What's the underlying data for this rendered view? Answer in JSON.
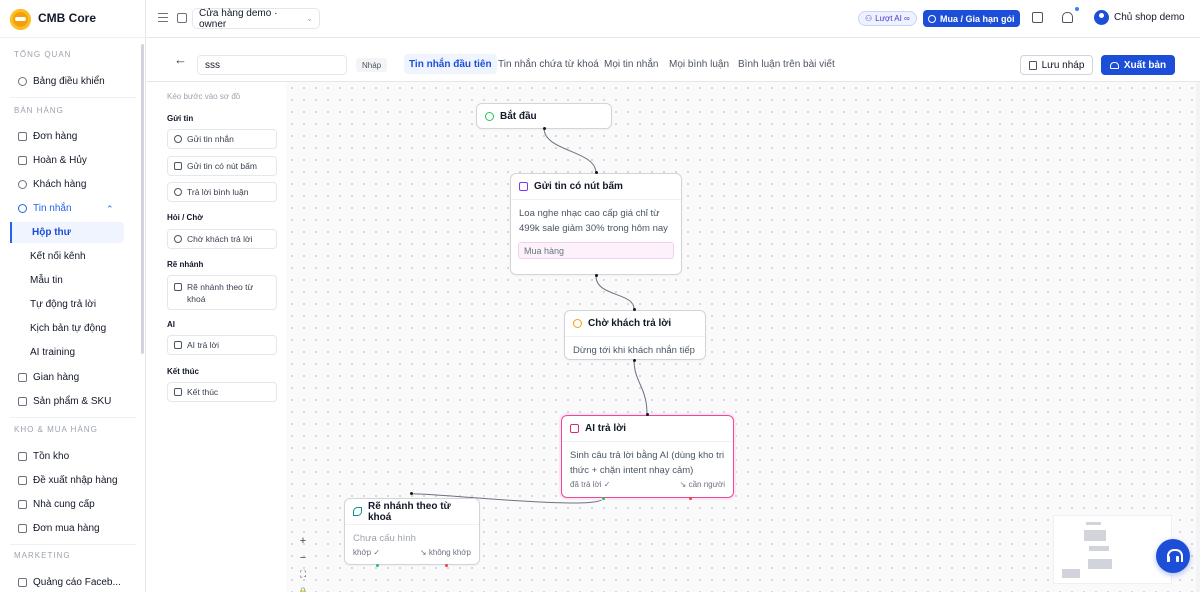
{
  "brand": {
    "name": "CMB Core"
  },
  "sidebar": {
    "sections": [
      {
        "title": "TỔNG QUAN"
      },
      {
        "title": "BÁN HÀNG"
      },
      {
        "title": "KHO & MUA HÀNG"
      },
      {
        "title": "MARKETING"
      }
    ],
    "items": [
      {
        "label": "Bảng điều khiển",
        "icon": "dashboard-icon"
      },
      {
        "label": "Đơn hàng",
        "icon": "bag-icon"
      },
      {
        "label": "Hoàn & Hủy",
        "icon": "return-icon"
      },
      {
        "label": "Khách hàng",
        "icon": "users-icon"
      },
      {
        "label": "Tin nhắn",
        "icon": "chat-icon"
      },
      {
        "label": "Gian hàng",
        "icon": "store-icon"
      },
      {
        "label": "Sản phẩm & SKU",
        "icon": "box-icon"
      },
      {
        "label": "Tồn kho",
        "icon": "inventory-icon"
      },
      {
        "label": "Đề xuất nhập hàng",
        "icon": "clipboard-icon"
      },
      {
        "label": "Nhà cung cấp",
        "icon": "truck-icon"
      },
      {
        "label": "Đơn mua hàng",
        "icon": "cart-icon"
      },
      {
        "label": "Quảng cáo Faceb...",
        "icon": "megaphone-icon"
      }
    ],
    "sub_items": [
      {
        "label": "Hộp thư"
      },
      {
        "label": "Kết nối kênh"
      },
      {
        "label": "Mẫu tin"
      },
      {
        "label": "Tự động trả lời"
      },
      {
        "label": "Kịch bản tự động"
      },
      {
        "label": "AI training"
      }
    ]
  },
  "topbar": {
    "store_label": "Cửa hàng demo · owner",
    "ai_pill": "Lượt AI ∞",
    "upgrade_label": "Mua / Gia hạn gói",
    "user_name": "Chủ shop demo"
  },
  "editor": {
    "flow_name": "sss",
    "status": "Nháp",
    "tabs": [
      {
        "label": "Tin nhắn đầu tiên"
      },
      {
        "label": "Tin nhắn chứa từ khoá"
      },
      {
        "label": "Mọi tin nhắn"
      },
      {
        "label": "Mọi bình luận"
      },
      {
        "label": "Bình luận trên bài viết"
      }
    ],
    "save_label": "Lưu nháp",
    "publish_label": "Xuất bản"
  },
  "palette": {
    "hint": "Kéo bước vào sơ đồ",
    "groups": [
      {
        "title": "Gửi tin",
        "items": [
          {
            "label": "Gửi tin nhắn"
          },
          {
            "label": "Gửi tin có nút bấm"
          },
          {
            "label": "Trả lời bình luận"
          }
        ]
      },
      {
        "title": "Hỏi / Chờ",
        "items": [
          {
            "label": "Chờ khách trả lời"
          }
        ]
      },
      {
        "title": "Rẽ nhánh",
        "items": [
          {
            "label": "Rẽ nhánh theo từ khoá"
          }
        ]
      },
      {
        "title": "AI",
        "items": [
          {
            "label": "AI trả lời"
          }
        ]
      },
      {
        "title": "Kết thúc",
        "items": [
          {
            "label": "Kết thúc"
          }
        ]
      }
    ]
  },
  "nodes": {
    "start": {
      "title": "Bắt đầu"
    },
    "button_msg": {
      "title": "Gửi tin có nút bấm",
      "body": "Loa nghe nhạc cao cấp giá chỉ từ 499k sale giảm 30% trong hôm nay",
      "button": "Mua hàng"
    },
    "wait": {
      "title": "Chờ khách trả lời",
      "body": "Dừng tới khi khách nhắn tiếp"
    },
    "ai": {
      "title": "AI trả lời",
      "body": "Sinh câu trả lời bằng AI (dùng kho tri thức + chặn intent nhạy cảm)",
      "port_ok": "đã trả lời ✓",
      "port_fail": "↘ cần người"
    },
    "branch": {
      "title": "Rẽ nhánh theo từ khoá",
      "body": "Chưa cấu hình",
      "port_ok": "khớp ✓",
      "port_fail": "↘ không khớp"
    }
  },
  "zoom_controls": {
    "zoom_in": "+",
    "zoom_out": "−",
    "fit": "⛶",
    "lock": "🔒"
  },
  "colors": {
    "accent": "#1d4ed8",
    "selected_node": "#ec4899",
    "canvas_bg": "#fafafa"
  }
}
